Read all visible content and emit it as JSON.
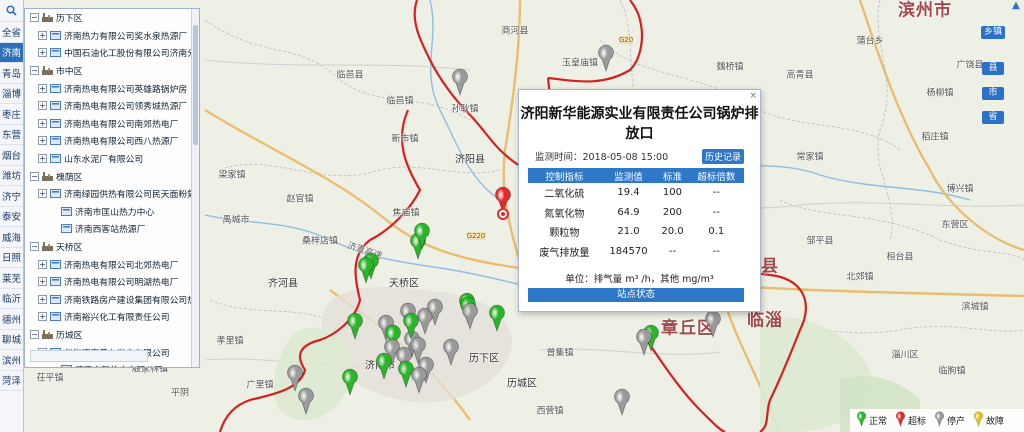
{
  "left_strip": {
    "search_icon": "search-icon",
    "items": [
      {
        "label": "全省",
        "active": false
      },
      {
        "label": "济南",
        "active": true
      },
      {
        "label": "青岛",
        "active": false
      },
      {
        "label": "淄博",
        "active": false
      },
      {
        "label": "枣庄",
        "active": false
      },
      {
        "label": "东营",
        "active": false
      },
      {
        "label": "烟台",
        "active": false
      },
      {
        "label": "潍坊",
        "active": false
      },
      {
        "label": "济宁",
        "active": false
      },
      {
        "label": "泰安",
        "active": false
      },
      {
        "label": "威海",
        "active": false
      },
      {
        "label": "日照",
        "active": false
      },
      {
        "label": "莱芜",
        "active": false
      },
      {
        "label": "临沂",
        "active": false
      },
      {
        "label": "德州",
        "active": false
      },
      {
        "label": "聊城",
        "active": false
      },
      {
        "label": "滨州",
        "active": false
      },
      {
        "label": "菏泽",
        "active": false
      }
    ]
  },
  "tree": [
    {
      "kind": "group",
      "label": "历下区"
    },
    {
      "kind": "child",
      "label": "济南热力有限公司奖水泉热源厂"
    },
    {
      "kind": "child",
      "label": "中国石油化工股份有限公司济南分公"
    },
    {
      "kind": "group",
      "label": "市中区"
    },
    {
      "kind": "child",
      "label": "济南热电有限公司英雄路锅炉房"
    },
    {
      "kind": "child",
      "label": "济南热电有限公司领秀城热源厂"
    },
    {
      "kind": "child",
      "label": "济南热电有限公司南郊热电厂"
    },
    {
      "kind": "child",
      "label": "济南热电有限公司西八热源厂"
    },
    {
      "kind": "child",
      "label": "山东水泥厂有限公司"
    },
    {
      "kind": "group",
      "label": "槐荫区"
    },
    {
      "kind": "child",
      "label": "济南绿园供热有限公司民天面粉集中"
    },
    {
      "kind": "leaf",
      "label": "济南市匡山热力中心"
    },
    {
      "kind": "leaf",
      "label": "济南西客站热源厂"
    },
    {
      "kind": "group",
      "label": "天桥区"
    },
    {
      "kind": "child",
      "label": "济南热电有限公司北郊热电厂"
    },
    {
      "kind": "child",
      "label": "济南热电有限公司明湖热电厂"
    },
    {
      "kind": "child",
      "label": "济南铁路房产建设集团有限公司热力"
    },
    {
      "kind": "child",
      "label": "济南裕兴化工有限责任公司"
    },
    {
      "kind": "group",
      "label": "历城区"
    },
    {
      "kind": "child",
      "label": "华能济南黄台发电有限公司"
    },
    {
      "kind": "leaf",
      "label": "济南东新热电有限公司"
    }
  ],
  "level_buttons": [
    "乡镇",
    "县",
    "市",
    "省"
  ],
  "map_labels": {
    "big": [
      {
        "text": "滨州市"
      },
      {
        "text": "章丘区"
      },
      {
        "text": "临淄"
      },
      {
        "text": "县"
      }
    ],
    "mid": [
      {
        "text": "济阳县"
      },
      {
        "text": "天桥区"
      },
      {
        "text": "齐河县"
      },
      {
        "text": "历下区"
      },
      {
        "text": "历城区"
      },
      {
        "text": "济南市"
      }
    ],
    "small": [
      {
        "text": "商河县"
      },
      {
        "text": "临邑县"
      },
      {
        "text": "玉皇庙镇"
      },
      {
        "text": "临邑镇"
      },
      {
        "text": "孙耿镇"
      },
      {
        "text": "新市镇"
      },
      {
        "text": "梁家镇"
      },
      {
        "text": "禹城市"
      },
      {
        "text": "焦庙镇"
      },
      {
        "text": "赵官镇"
      },
      {
        "text": "桑梓店镇"
      },
      {
        "text": "茌平镇"
      },
      {
        "text": "孝里镇"
      },
      {
        "text": "平阴"
      },
      {
        "text": "广里镇"
      },
      {
        "text": "殷家林镇"
      },
      {
        "text": "普集镇"
      },
      {
        "text": "西营镇"
      },
      {
        "text": "高青县"
      },
      {
        "text": "魏桥镇"
      },
      {
        "text": "常家镇"
      },
      {
        "text": "邹平县"
      },
      {
        "text": "桓台县"
      },
      {
        "text": "北郊镇"
      },
      {
        "text": "淄川区"
      },
      {
        "text": "博兴镇"
      },
      {
        "text": "杨柳镇"
      },
      {
        "text": "临朐镇"
      },
      {
        "text": "广饶县"
      },
      {
        "text": "稻庄镇"
      },
      {
        "text": "东营区"
      },
      {
        "text": "蒲台乡"
      },
      {
        "text": "滨城镇"
      }
    ],
    "road": [
      {
        "text": "济青高速"
      },
      {
        "text": "G220"
      },
      {
        "text": "G20"
      }
    ]
  },
  "popup": {
    "title": "济阳新华能源实业有限责任公司锅炉排放口",
    "time_label": "监测时间：2018-05-08 15:00",
    "history_button": "历史记录",
    "columns": [
      "控制指标",
      "监测值",
      "标准",
      "超标倍数"
    ],
    "rows": [
      [
        "二氧化硫",
        "19.4",
        "100",
        "--"
      ],
      [
        "氮氧化物",
        "64.9",
        "200",
        "--"
      ],
      [
        "颗粒物",
        "21.0",
        "20.0",
        "0.1"
      ],
      [
        "废气排放量",
        "184570",
        "--",
        "--"
      ]
    ],
    "unit": "单位：排气量 m³ /h，其他 mg/m³",
    "status_button": "站点状态",
    "close": "×"
  },
  "legend": [
    {
      "label": "正常",
      "color": "#2bb52b"
    },
    {
      "label": "超标",
      "color": "#e22a2a"
    },
    {
      "label": "停产",
      "color": "#9a9a9a"
    },
    {
      "label": "故障",
      "color": "#e0c21a"
    }
  ],
  "colors": {
    "normal": "#2bb52b",
    "exceed": "#e22a2a",
    "stopped": "#9a9a9a",
    "fault": "#e0c21a",
    "accent": "#2f78c8",
    "boundary": "#d62020"
  },
  "markers": [
    {
      "status": "stopped"
    },
    {
      "status": "stopped"
    },
    {
      "status": "normal"
    },
    {
      "status": "exceed"
    },
    {
      "status": "normal"
    },
    {
      "status": "normal"
    },
    {
      "status": "normal"
    },
    {
      "status": "normal"
    },
    {
      "status": "stopped"
    },
    {
      "status": "stopped"
    },
    {
      "status": "stopped"
    },
    {
      "status": "normal"
    },
    {
      "status": "normal"
    },
    {
      "status": "normal"
    },
    {
      "status": "stopped"
    },
    {
      "status": "stopped"
    },
    {
      "status": "normal"
    },
    {
      "status": "stopped"
    },
    {
      "status": "stopped"
    },
    {
      "status": "stopped"
    },
    {
      "status": "stopped"
    },
    {
      "status": "normal"
    },
    {
      "status": "stopped"
    },
    {
      "status": "stopped"
    },
    {
      "status": "normal"
    },
    {
      "status": "stopped"
    },
    {
      "status": "stopped"
    },
    {
      "status": "normal"
    },
    {
      "status": "normal"
    },
    {
      "status": "stopped"
    },
    {
      "status": "stopped"
    },
    {
      "status": "stopped"
    },
    {
      "status": "normal"
    },
    {
      "status": "stopped"
    }
  ]
}
